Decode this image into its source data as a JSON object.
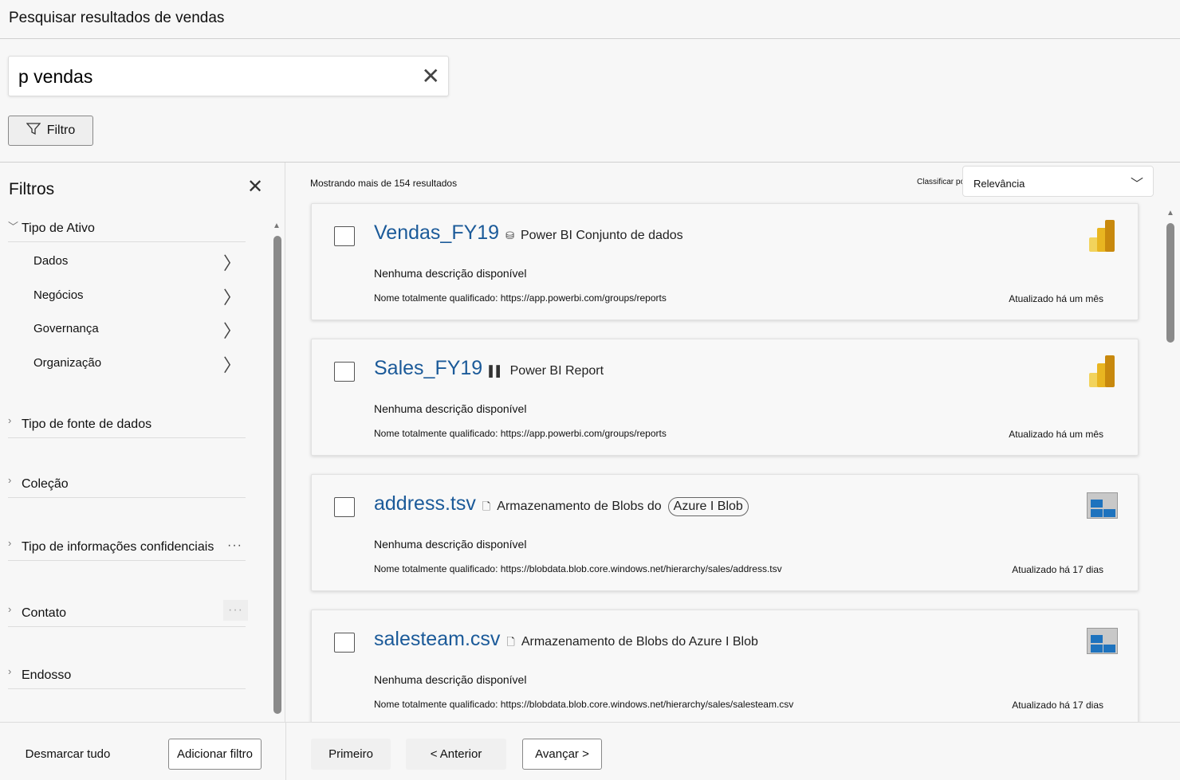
{
  "header": {
    "title": "Pesquisar resultados de vendas"
  },
  "search": {
    "value": "p vendas"
  },
  "filter_button": "Filtro",
  "filters": {
    "title": "Filtros",
    "sections": [
      {
        "label": "Tipo de Ativo",
        "items": [
          "Dados",
          "Negócios",
          "Governança",
          "Organização"
        ]
      },
      {
        "label": "Tipo de fonte de dados"
      },
      {
        "label": "Coleção"
      },
      {
        "label": "Tipo de informações confidenciais"
      },
      {
        "label": "Contato"
      },
      {
        "label": "Endosso"
      }
    ],
    "clear_all": "Desmarcar tudo",
    "add_filter": "Adicionar filtro"
  },
  "results": {
    "count_text": "Mostrando mais de 154 resultados",
    "sort_label": "Classificar por:",
    "sort_value": "Relevância",
    "items": [
      {
        "title": "Vendas_FY19",
        "type": "Power BI Conjunto de dados",
        "icon": "database-icon",
        "desc": "Nenhuma descrição disponível",
        "fqn": "Nome totalmente qualificado: https://app.powerbi.com/groups/reports",
        "updated": "Atualizado há um mês",
        "logo": "powerbi"
      },
      {
        "title": "Sales_FY19",
        "type": "Power BI Report",
        "icon": "report-icon",
        "desc": "Nenhuma descrição disponível",
        "fqn": "Nome totalmente qualificado: https://app.powerbi.com/groups/reports",
        "updated": "Atualizado há um mês",
        "logo": "powerbi"
      },
      {
        "title": "address.tsv",
        "type": "Armazenamento de Blobs do",
        "badge": "Azure I Blob",
        "icon": "file-icon",
        "desc": "Nenhuma descrição disponível",
        "fqn": "Nome totalmente qualificado: https://blobdata.blob.core.windows.net/hierarchy/sales/address.tsv",
        "updated": "Atualizado há 17 dias",
        "logo": "blob"
      },
      {
        "title": "salesteam.csv",
        "type": "Armazenamento de Blobs do Azure I Blob",
        "icon": "file-icon",
        "desc": "Nenhuma descrição disponível",
        "fqn": "Nome totalmente qualificado: https://blobdata.blob.core.windows.net/hierarchy/sales/salesteam.csv",
        "updated": "Atualizado há 17 dias",
        "logo": "blob"
      }
    ]
  },
  "pagination": {
    "first": "Primeiro",
    "prev": "< Anterior",
    "next": "Avançar >"
  }
}
